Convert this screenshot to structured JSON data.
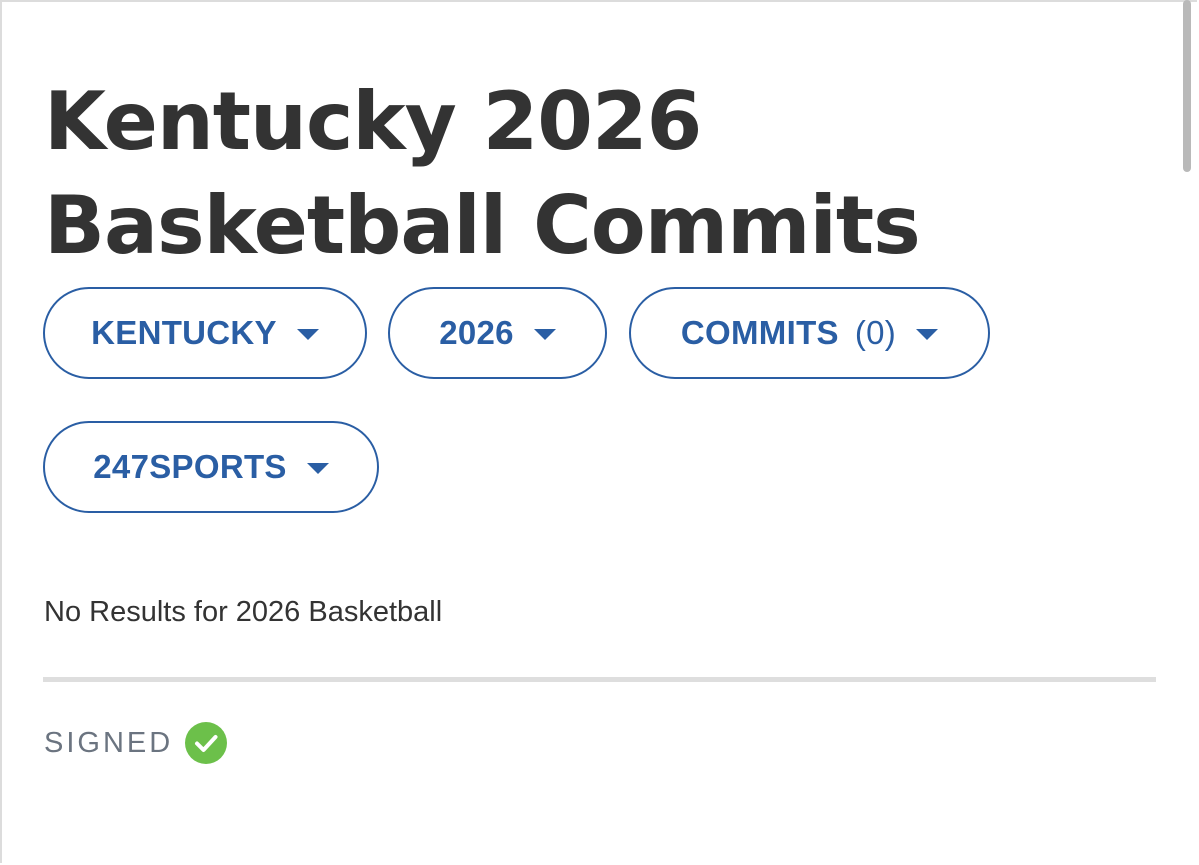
{
  "page": {
    "title": "Kentucky 2026 Basketball Commits"
  },
  "filters": {
    "school": {
      "label": "KENTUCKY",
      "icon": "caret-down-icon"
    },
    "year": {
      "label": "2026",
      "icon": "caret-down-icon"
    },
    "commits": {
      "label": "COMMITS",
      "count": "(0)",
      "icon": "caret-down-icon"
    },
    "source": {
      "label": "247SPORTS",
      "icon": "caret-down-icon"
    }
  },
  "results": {
    "message": "No Results for 2026 Basketball"
  },
  "signed": {
    "label": "SIGNED",
    "icon": "check-circle-icon",
    "icon_color": "#6cc04a"
  },
  "colors": {
    "accent": "#2a5ea4",
    "title_text": "#333333",
    "muted_text": "#6b7480",
    "divider": "#dedede"
  }
}
